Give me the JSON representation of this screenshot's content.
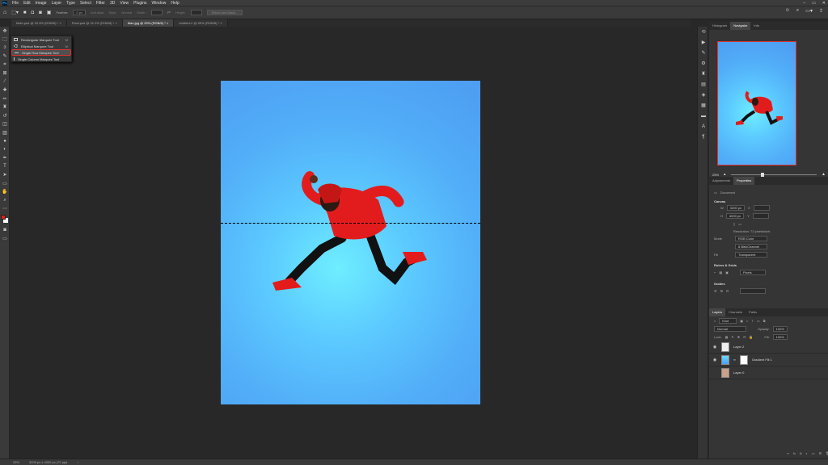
{
  "menubar": {
    "app_icon": "Ps",
    "items": [
      "File",
      "Edit",
      "Image",
      "Layer",
      "Type",
      "Select",
      "Filter",
      "3D",
      "View",
      "Plugins",
      "Window",
      "Help"
    ]
  },
  "options": {
    "feather_label": "Feather:",
    "feather_value": "0 px",
    "antialias_label": "Anti-alias",
    "style_label": "Style:",
    "style_value": "Normal",
    "width_label": "Width:",
    "height_label": "Height:",
    "select_mask_label": "Select and Mask..."
  },
  "tabs": [
    "Main.psd @ 33.3% (RGB/8) *",
    "Float.psd @ 31.2% (RGB/8) *",
    "Man.jpg @ 25% (RGB/8) *",
    "Untitled-2 @ 50% (RGB/8) *"
  ],
  "active_tab": 2,
  "flyout": {
    "items": [
      {
        "label": "Rectangular Marquee Tool",
        "shortcut": "M"
      },
      {
        "label": "Elliptical Marquee Tool",
        "shortcut": "M"
      },
      {
        "label": "Single Row Marquee Tool",
        "shortcut": ""
      },
      {
        "label": "Single Column Marquee Tool",
        "shortcut": ""
      }
    ],
    "selected": 2
  },
  "navigator": {
    "tabs": [
      "Histogram",
      "Navigator",
      "Info"
    ],
    "active": 1,
    "zoom": "25%"
  },
  "properties": {
    "tabs": [
      "Adjustments",
      "Properties"
    ],
    "active": 1,
    "doc_label": "Document",
    "canvas_title": "Canvas",
    "w_label": "W",
    "w_value": "3200 px",
    "h_label": "H",
    "h_value": "4000 px",
    "x_label": "X",
    "y_label": "Y",
    "resolution": "Resolution: 72 pixels/inch",
    "mode_label": "Mode",
    "mode_value": "RGB Color",
    "depth_value": "8 Bits/Channel",
    "fill_label": "Fill",
    "fill_value": "Transparent",
    "rulers_title": "Rulers & Grids",
    "units_value": "Pixels",
    "guides_title": "Guides"
  },
  "layers": {
    "tabs": [
      "Layers",
      "Channels",
      "Paths"
    ],
    "active": 0,
    "kind_label": "Kind",
    "blend_mode": "Normal",
    "opacity_label": "Opacity:",
    "opacity_value": "100%",
    "lock_label": "Lock:",
    "fill_label": "Fill:",
    "fill_value": "100%",
    "items": [
      {
        "name": "Layer 2",
        "visible": true
      },
      {
        "name": "Gradient Fill 1",
        "visible": true
      },
      {
        "name": "Layer 0",
        "visible": false
      }
    ]
  },
  "status": {
    "zoom": "25%",
    "doc_info": "3200 px x 4000 px (72 ppi)"
  },
  "colors": {
    "foreground": "#e31b1b",
    "background": "#ffffff",
    "selection_highlight": "#e03030"
  }
}
